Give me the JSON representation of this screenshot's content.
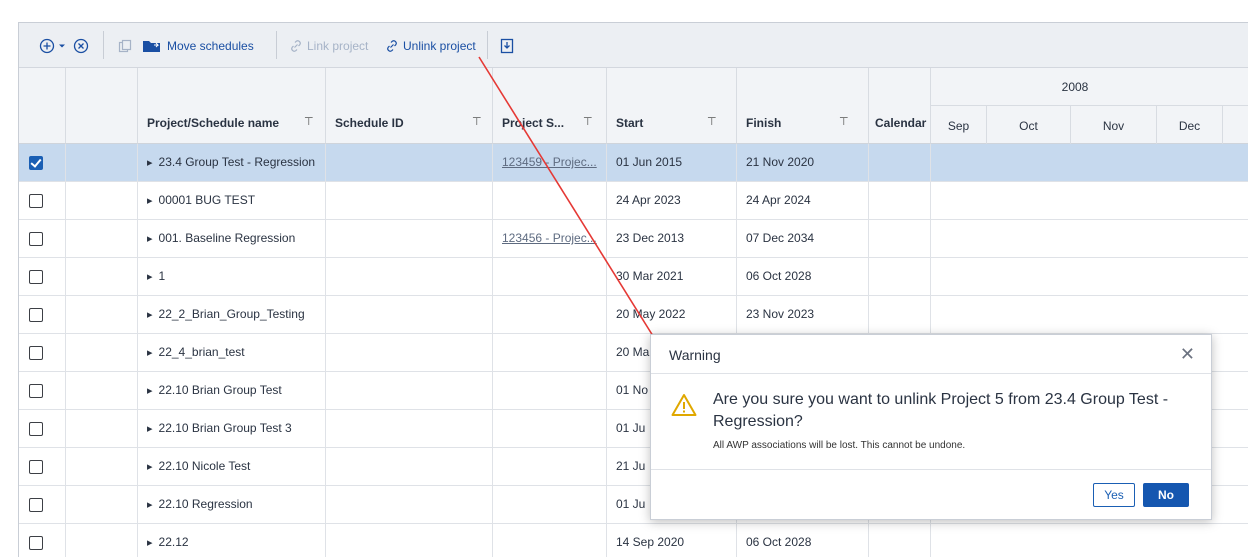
{
  "toolbar": {
    "add_icon": "plus-circle-icon",
    "remove_icon": "x-circle-icon",
    "copy_icon": "copy-icon",
    "move_label": "Move schedules",
    "link_label": "Link project",
    "unlink_label": "Unlink project",
    "export_icon": "export-icon"
  },
  "columns": {
    "name": "Project/Schedule name",
    "schedule_id": "Schedule ID",
    "project_s": "Project S...",
    "start": "Start",
    "finish": "Finish",
    "calendar": "Calendar"
  },
  "gantt": {
    "year": "2008",
    "months": [
      "Sep",
      "Oct",
      "Nov",
      "Dec"
    ]
  },
  "rows": [
    {
      "name": "23.4 Group Test - Regression",
      "project": "123459 - Projec...",
      "start": "01 Jun 2015",
      "finish": "21 Nov 2020",
      "checked": true
    },
    {
      "name": "00001 BUG TEST",
      "project": "",
      "start": "24 Apr 2023",
      "finish": "24 Apr 2024",
      "checked": false
    },
    {
      "name": "001. Baseline Regression",
      "project": "123456 - Projec...",
      "start": "23 Dec 2013",
      "finish": "07 Dec 2034",
      "checked": false
    },
    {
      "name": "1",
      "project": "",
      "start": "30 Mar 2021",
      "finish": "06 Oct 2028",
      "checked": false
    },
    {
      "name": "22_2_Brian_Group_Testing",
      "project": "",
      "start": "20 May 2022",
      "finish": "23 Nov 2023",
      "checked": false
    },
    {
      "name": "22_4_brian_test",
      "project": "",
      "start": "20 Ma",
      "finish": "",
      "checked": false
    },
    {
      "name": "22.10 Brian Group Test",
      "project": "",
      "start": "01 No",
      "finish": "",
      "checked": false
    },
    {
      "name": "22.10 Brian Group Test 3",
      "project": "",
      "start": "01 Ju",
      "finish": "",
      "checked": false
    },
    {
      "name": "22.10 Nicole Test",
      "project": "",
      "start": "21 Ju",
      "finish": "",
      "checked": false
    },
    {
      "name": "22.10 Regression",
      "project": "",
      "start": "01 Ju",
      "finish": "",
      "checked": false
    },
    {
      "name": "22.12",
      "project": "",
      "start": "14 Sep 2020",
      "finish": "06 Oct 2028",
      "checked": false
    }
  ],
  "dialog": {
    "title": "Warning",
    "icon": "warning-triangle-icon",
    "message": "Are you sure you want to unlink Project 5 from 23.4 Group Test - Regression?",
    "submessage": "All AWP associations will be lost. This cannot be undone.",
    "yes_label": "Yes",
    "no_label": "No"
  },
  "colors": {
    "accent": "#1557b0",
    "selected_row": "#c6d9ee",
    "annotation_arrow": "#e53935"
  }
}
